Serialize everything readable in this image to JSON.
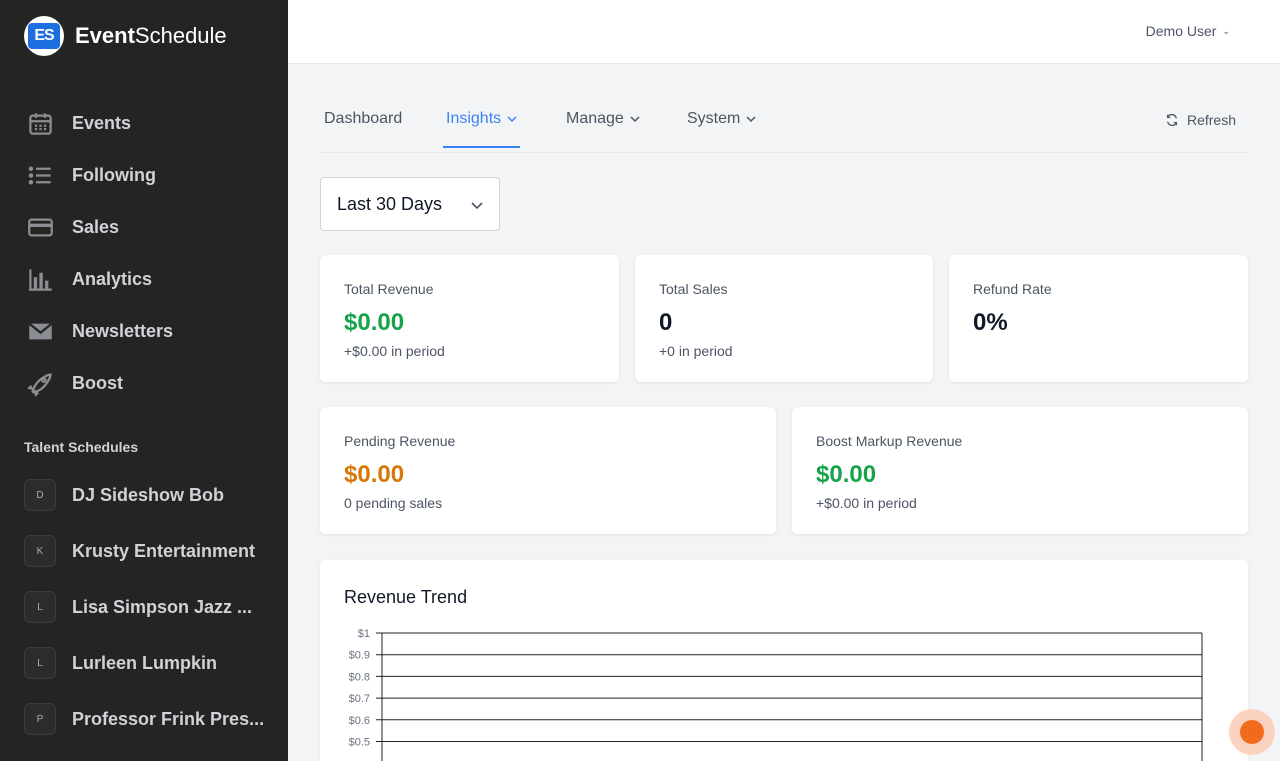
{
  "brand": {
    "name_bold": "Event",
    "name_rest": "Schedule",
    "logo": "ES"
  },
  "sidebar": {
    "items": [
      {
        "label": "Events",
        "icon": "calendar-icon"
      },
      {
        "label": "Following",
        "icon": "list-icon"
      },
      {
        "label": "Sales",
        "icon": "credit-card-icon"
      },
      {
        "label": "Analytics",
        "icon": "bar-chart-icon"
      },
      {
        "label": "Newsletters",
        "icon": "envelope-icon"
      },
      {
        "label": "Boost",
        "icon": "rocket-icon"
      }
    ],
    "section_title": "Talent Schedules",
    "talent": [
      {
        "initial": "D",
        "name": "DJ Sideshow Bob"
      },
      {
        "initial": "K",
        "name": "Krusty Entertainment"
      },
      {
        "initial": "L",
        "name": "Lisa Simpson Jazz ..."
      },
      {
        "initial": "L",
        "name": "Lurleen Lumpkin"
      },
      {
        "initial": "P",
        "name": "Professor Frink Pres..."
      }
    ]
  },
  "header": {
    "user": "Demo User"
  },
  "tabs": [
    {
      "label": "Dashboard"
    },
    {
      "label": "Insights"
    },
    {
      "label": "Manage"
    },
    {
      "label": "System"
    }
  ],
  "refresh_label": "Refresh",
  "range_select": {
    "value": "Last 30 Days"
  },
  "stats": {
    "total_revenue": {
      "label": "Total Revenue",
      "value": "$0.00",
      "sub": "+$0.00 in period"
    },
    "total_sales": {
      "label": "Total Sales",
      "value": "0",
      "sub": "+0 in period"
    },
    "refund_rate": {
      "label": "Refund Rate",
      "value": "0%"
    },
    "pending_revenue": {
      "label": "Pending Revenue",
      "value": "$0.00",
      "sub": "0 pending sales"
    },
    "boost_markup": {
      "label": "Boost Markup Revenue",
      "value": "$0.00",
      "sub": "+$0.00 in period"
    }
  },
  "colors": {
    "green": "#16a34a",
    "orange": "#d97706",
    "accent": "#3b82f6",
    "sidebar_bg": "#242424"
  },
  "chart_data": {
    "type": "line",
    "title": "Revenue Trend",
    "yticks": [
      "$1",
      "$0.9",
      "$0.8",
      "$0.7",
      "$0.6",
      "$0.5"
    ],
    "ylim": [
      0,
      1
    ],
    "series": [],
    "grid": true
  }
}
